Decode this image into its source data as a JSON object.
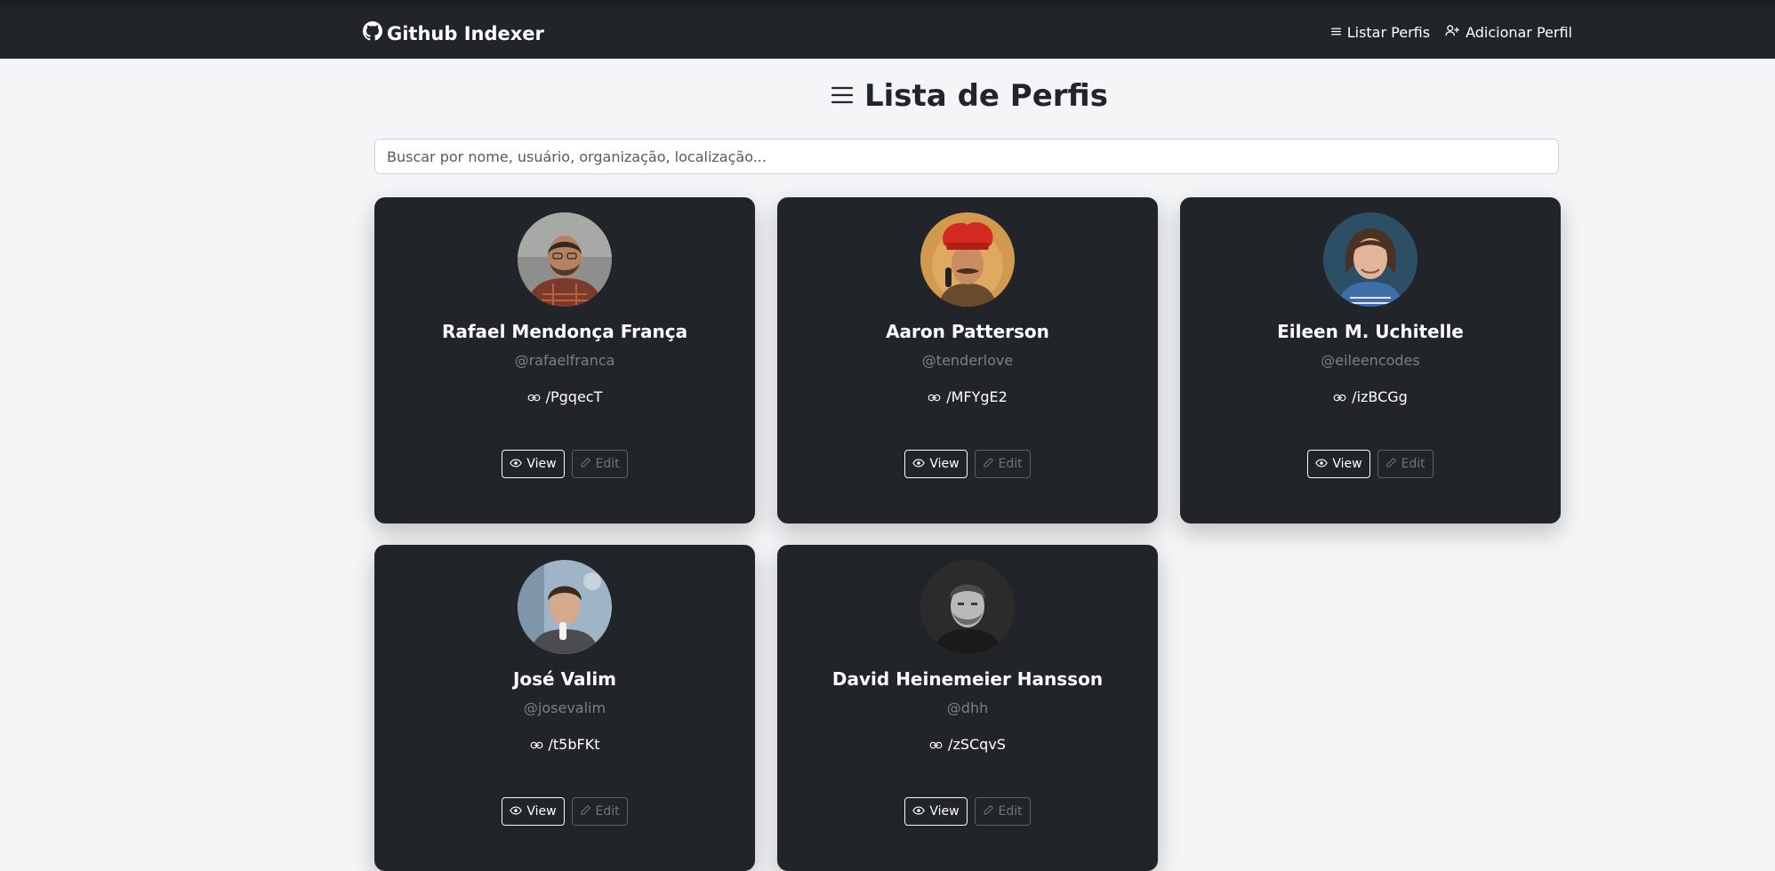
{
  "navbar": {
    "brand": "Github Indexer",
    "brand_icon": "github-icon",
    "links": [
      {
        "label": "Listar Perfis",
        "icon": "list-icon"
      },
      {
        "label": "Adicionar Perfil",
        "icon": "person-add-icon"
      }
    ]
  },
  "page": {
    "title": "Lista de Perfis",
    "title_icon": "list-icon"
  },
  "search": {
    "placeholder": "Buscar por nome, usuário, organização, localização...",
    "value": ""
  },
  "profiles": [
    {
      "name": "Rafael Mendonça França",
      "username": "@rafaelfranca",
      "short_link": "/PgqecT",
      "view_label": "View",
      "edit_label": "Edit"
    },
    {
      "name": "Aaron Patterson",
      "username": "@tenderlove",
      "short_link": "/MFYgE2",
      "view_label": "View",
      "edit_label": "Edit"
    },
    {
      "name": "Eileen M. Uchitelle",
      "username": "@eileencodes",
      "short_link": "/izBCGg",
      "view_label": "View",
      "edit_label": "Edit"
    },
    {
      "name": "José Valim",
      "username": "@josevalim",
      "short_link": "/t5bFKt",
      "view_label": "View",
      "edit_label": "Edit"
    },
    {
      "name": "David Heinemeier Hansson",
      "username": "@dhh",
      "short_link": "/zSCqvS",
      "view_label": "View",
      "edit_label": "Edit"
    }
  ],
  "colors": {
    "navbar_bg": "#212529",
    "page_bg": "#f4f5f7",
    "card_bg": "#212529",
    "muted_text": "#7b8086"
  }
}
